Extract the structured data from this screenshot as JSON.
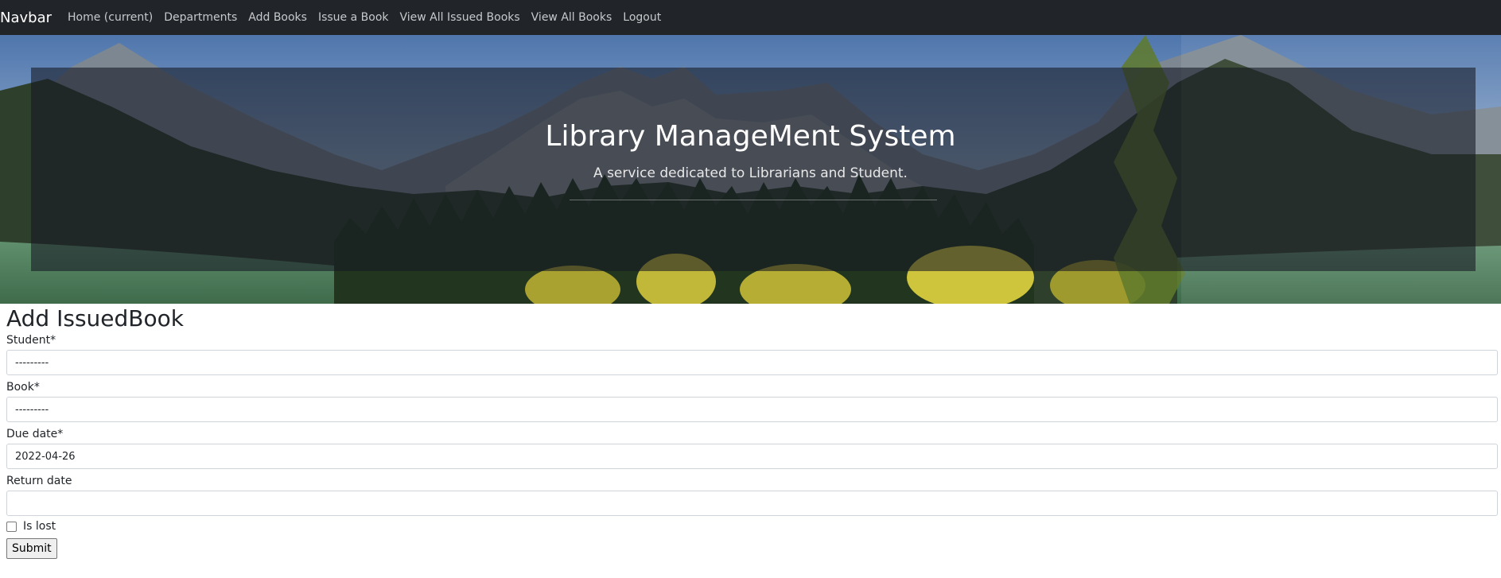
{
  "navbar": {
    "brand": "Navbar",
    "links": [
      "Home (current)",
      "Departments",
      "Add Books",
      "Issue a Book",
      "View All Issued Books",
      "View All Books",
      "Logout"
    ]
  },
  "hero": {
    "title": "Library ManageMent System",
    "subtitle": "A service dedicated to Librarians and Student."
  },
  "form": {
    "heading": "Add IssuedBook",
    "student": {
      "label": "Student*",
      "value": "---------"
    },
    "book": {
      "label": "Book*",
      "value": "---------"
    },
    "due_date": {
      "label": "Due date*",
      "value": "2022-04-26"
    },
    "return_date": {
      "label": "Return date",
      "value": ""
    },
    "is_lost": {
      "label": "Is lost",
      "checked": false
    },
    "submit_label": "Submit"
  },
  "colors": {
    "navbar_bg": "#212529",
    "nav_link": "#c7c9cc",
    "hero_overlay": "rgba(20,24,34,0.58)"
  }
}
